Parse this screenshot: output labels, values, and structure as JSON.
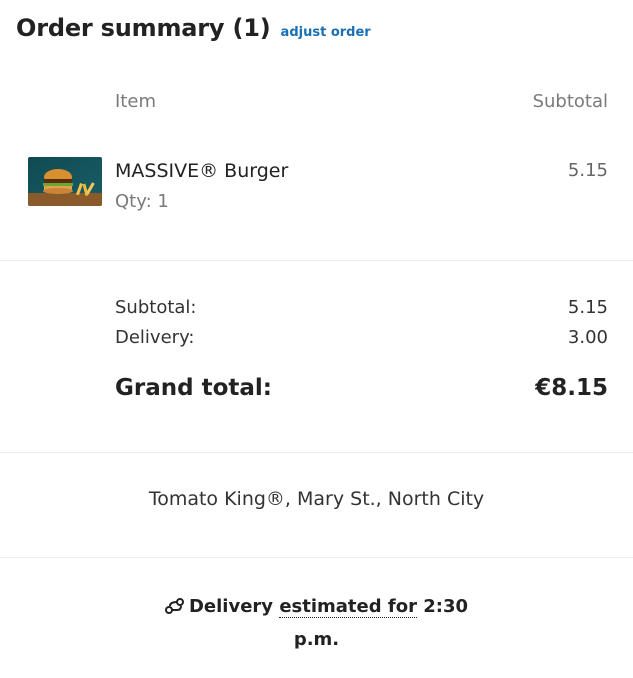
{
  "header": {
    "title": "Order summary (1)",
    "adjust_label": "adjust order"
  },
  "columns": {
    "item": "Item",
    "subtotal": "Subtotal"
  },
  "items": [
    {
      "name": "MASSIVE® Burger",
      "qty": "Qty: 1",
      "price": "5.15",
      "thumbnail_icon": "burger-photo"
    }
  ],
  "totals": {
    "subtotal_label": "Subtotal:",
    "subtotal_value": "5.15",
    "delivery_label": "Delivery:",
    "delivery_value": "3.00",
    "grand_label": "Grand total:",
    "grand_value": "€8.15"
  },
  "store": "Tomato King®, Mary St., North City",
  "delivery_estimate": {
    "prefix": "Delivery",
    "dotted_text": "estimated for",
    "time": "2:30 p.m.",
    "icon": "delivery-route-icon"
  },
  "colors": {
    "link": "#1a6fb5",
    "muted": "#7a7a7a",
    "divider": "#ececec"
  }
}
